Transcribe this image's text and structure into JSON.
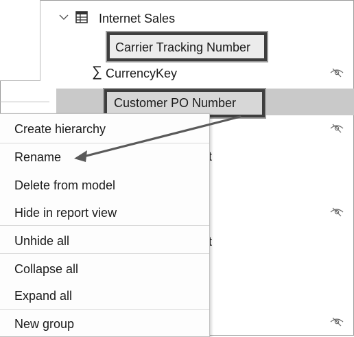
{
  "tree": {
    "table_name": "Internet Sales",
    "fields": [
      {
        "label": "Carrier Tracking Number",
        "hidden": false
      },
      {
        "label": "CurrencyKey",
        "hidden": true,
        "is_measure": true
      },
      {
        "label": "Customer PO Number",
        "hidden": false,
        "selected": true
      }
    ],
    "partial_labels": [
      "t",
      "t"
    ]
  },
  "context_menu": {
    "items": [
      {
        "label": "Create hierarchy"
      },
      {
        "label": "Rename"
      },
      {
        "label": "Delete from model"
      },
      {
        "label": "Hide in report view"
      },
      {
        "label": "Unhide all"
      },
      {
        "label": "Collapse all"
      },
      {
        "label": "Expand all"
      },
      {
        "label": "New group"
      }
    ]
  },
  "icons": {
    "expand": "chevron-down-icon",
    "table": "table-icon",
    "measure": "sigma-icon",
    "hidden": "eye-hidden-icon"
  },
  "colors": {
    "selection": "#c9c9c9",
    "callout_border": "#3e3e3e",
    "arrow": "#5a5a5a"
  }
}
